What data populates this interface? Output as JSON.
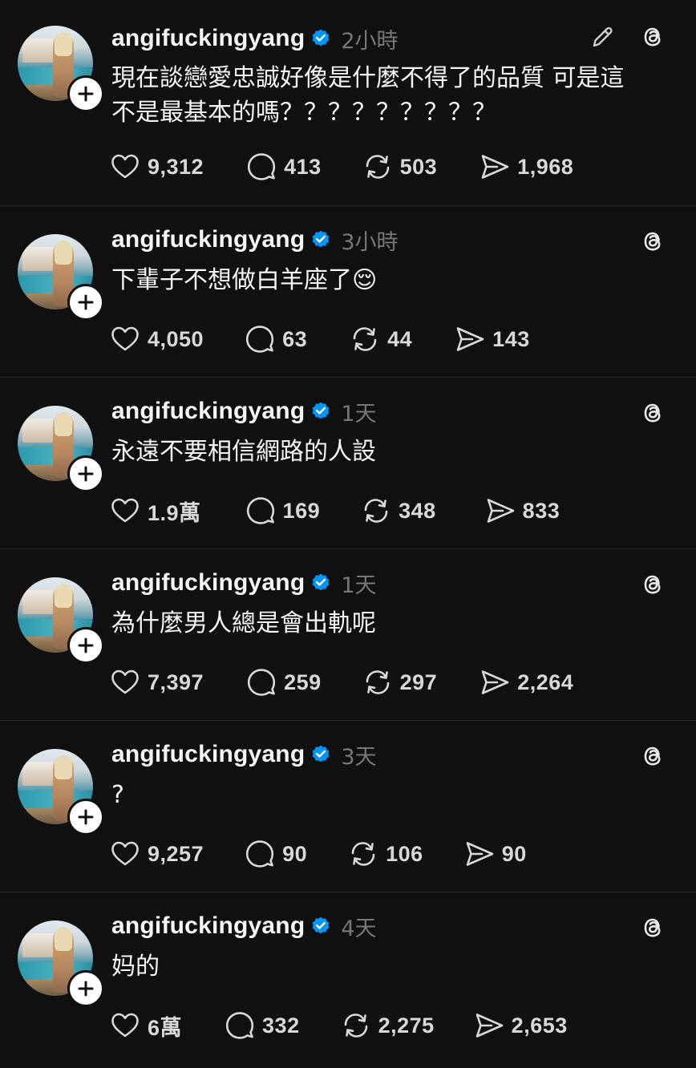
{
  "colors": {
    "background": "#101010",
    "text": "#f3f5f7",
    "muted": "#777777",
    "verified": "#0095f6",
    "divider": "#262626"
  },
  "posts": [
    {
      "username": "angifuckingyang",
      "time": "2小時",
      "text": "現在談戀愛忠誠好像是什麼不得了的品質 可是這\n不是最基本的嗎？？？？？？？？？",
      "likes": "9,312",
      "replies": "413",
      "reposts": "503",
      "shares": "1,968",
      "has_edit": true
    },
    {
      "username": "angifuckingyang",
      "time": "3小時",
      "text": "下輩子不想做白羊座了😌",
      "likes": "4,050",
      "replies": "63",
      "reposts": "44",
      "shares": "143",
      "has_edit": false
    },
    {
      "username": "angifuckingyang",
      "time": "1天",
      "text": "永遠不要相信網路的人設",
      "likes": "1.9萬",
      "replies": "169",
      "reposts": "348",
      "shares": "833",
      "has_edit": false
    },
    {
      "username": "angifuckingyang",
      "time": "1天",
      "text": "為什麼男人總是會出軌呢",
      "likes": "7,397",
      "replies": "259",
      "reposts": "297",
      "shares": "2,264",
      "has_edit": false
    },
    {
      "username": "angifuckingyang",
      "time": "3天",
      "text": "?",
      "likes": "9,257",
      "replies": "90",
      "reposts": "106",
      "shares": "90",
      "has_edit": false
    },
    {
      "username": "angifuckingyang",
      "time": "4天",
      "text": "妈的",
      "likes": "6萬",
      "replies": "332",
      "reposts": "2,275",
      "shares": "2,653",
      "has_edit": false
    }
  ],
  "icons": {
    "follow": "plus-icon",
    "verified": "verified-badge-icon",
    "edit": "pencil-icon",
    "threads": "threads-logo-icon",
    "like": "heart-icon",
    "reply": "comment-bubble-icon",
    "repost": "repost-icon",
    "share": "send-icon"
  }
}
